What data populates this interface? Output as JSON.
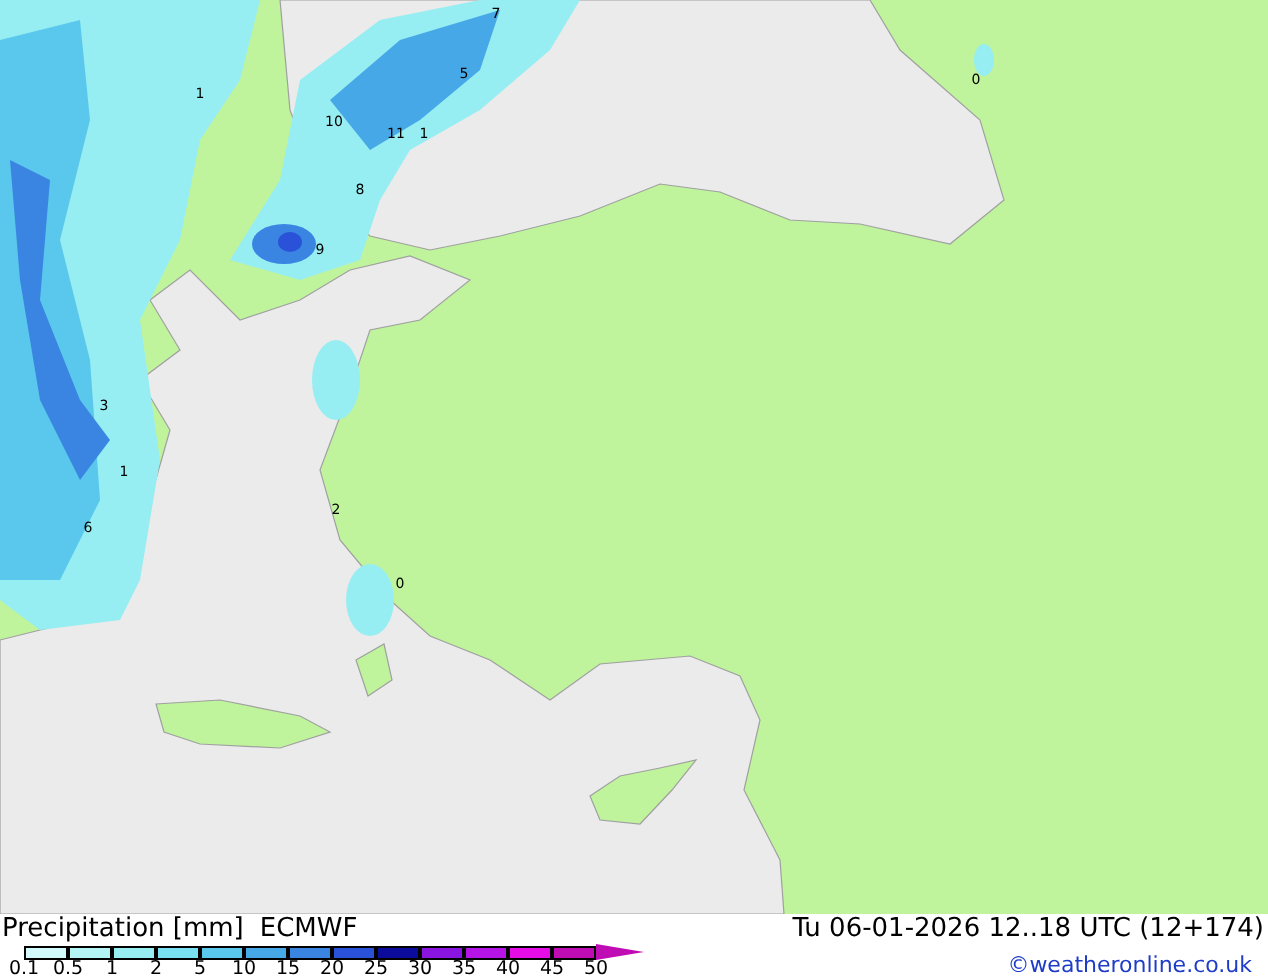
{
  "map": {
    "labels": [
      "0",
      "10",
      "11",
      "1",
      "9",
      "5",
      "7",
      "8",
      "3",
      "2",
      "6",
      "1",
      "1",
      "0"
    ]
  },
  "legend": {
    "title": "Precipitation [mm]",
    "model": "ECMWF",
    "bins": [
      {
        "label": "0.1",
        "color": "#d2fafa"
      },
      {
        "label": "0.5",
        "color": "#b4f4f4"
      },
      {
        "label": "1",
        "color": "#96eef2"
      },
      {
        "label": "2",
        "color": "#78e0f0"
      },
      {
        "label": "5",
        "color": "#5ac8ec"
      },
      {
        "label": "10",
        "color": "#46a8e6"
      },
      {
        "label": "15",
        "color": "#3a84e2"
      },
      {
        "label": "20",
        "color": "#2a52d8"
      },
      {
        "label": "25",
        "color": "#0c0c9c"
      },
      {
        "label": "30",
        "color": "#8a14e0"
      },
      {
        "label": "35",
        "color": "#b414e6"
      },
      {
        "label": "40",
        "color": "#e60ce6"
      },
      {
        "label": "45",
        "color": "#c00cb4"
      }
    ],
    "end_label": "50"
  },
  "valid_time": "Tu 06-01-2026 12..18 UTC (12+174)",
  "credit": "©weatheronline.co.uk"
}
